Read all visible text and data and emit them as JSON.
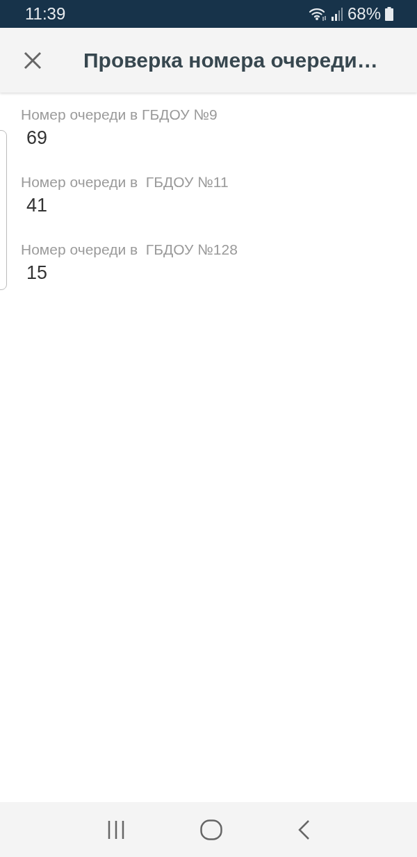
{
  "status_bar": {
    "time": "11:39",
    "battery": "68%"
  },
  "app_bar": {
    "title": "Проверка номера очереди…"
  },
  "items": [
    {
      "label": "Номер очереди в ГБДОУ №9",
      "value": "69"
    },
    {
      "label": "Номер очереди в  ГБДОУ №11",
      "value": "41"
    },
    {
      "label": "Номер очереди в  ГБДОУ №128",
      "value": "15"
    }
  ]
}
